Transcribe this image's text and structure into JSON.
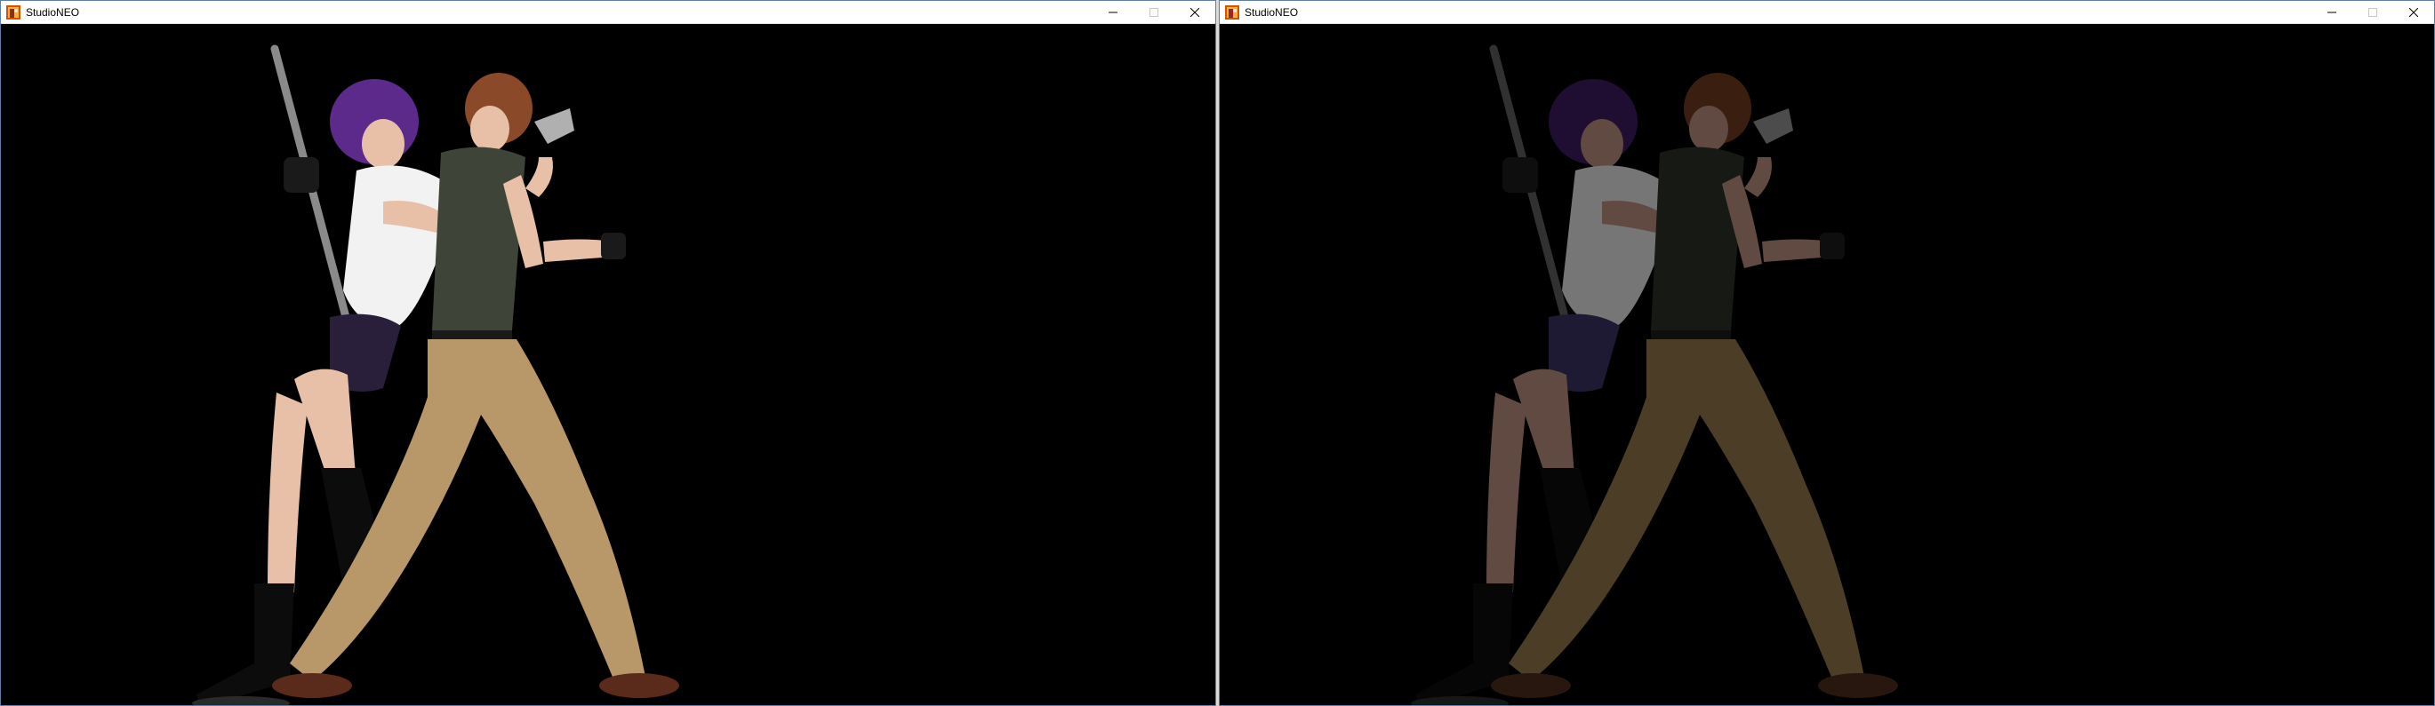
{
  "windows": [
    {
      "title": "StudioNEO",
      "icon": "studioneo-app-icon",
      "controls": [
        "minimize-icon",
        "maximize-icon",
        "close-icon"
      ],
      "scene": "figures-fully-lit"
    },
    {
      "title": "StudioNEO",
      "icon": "studioneo-app-icon",
      "controls": [
        "minimize-icon",
        "maximize-icon",
        "close-icon"
      ],
      "scene": "figures-dim-lit"
    }
  ],
  "colors": {
    "window_border": "#5d7fa8",
    "titlebar_bg": "#ffffff",
    "viewport_bg": "#000000",
    "icon_accent": "#c0392b"
  }
}
